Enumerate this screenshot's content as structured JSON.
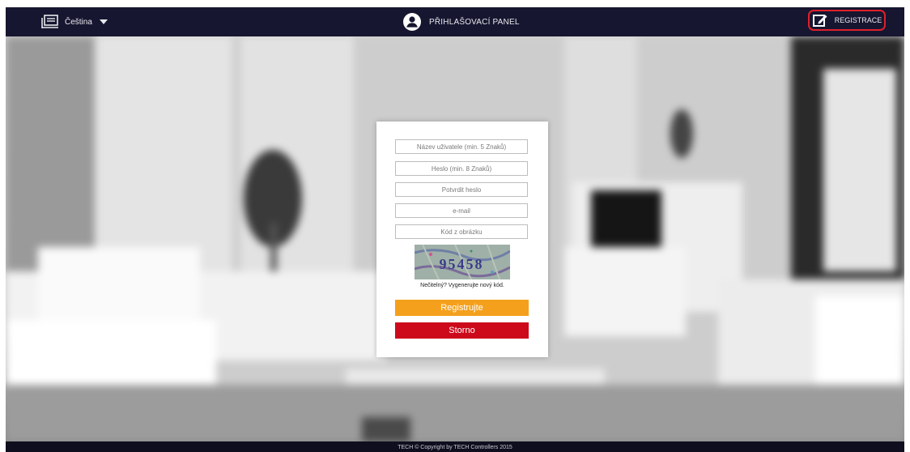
{
  "header": {
    "language": "Čeština",
    "panel_title": "PŘIHLAŠOVACÍ PANEL",
    "register_link": "REGISTRACE"
  },
  "form": {
    "username_placeholder": "Název uživatele (min. 5 Znaků)",
    "password_placeholder": "Heslo (min. 8 Znaků)",
    "confirm_password_placeholder": "Potvrdit heslo",
    "email_placeholder": "e-mail",
    "captcha_code_placeholder": "Kód z obrázku",
    "captcha_text": "95458",
    "refresh_captcha": "Nečitelný? Vygenerujte nový kód.",
    "register_button": "Registrujte",
    "cancel_button": "Storno"
  },
  "footer": {
    "copyright": "TECH © Copyright by TECH Controllers 2015"
  },
  "colors": {
    "topbar": "#161630",
    "register_button": "#f4a01c",
    "cancel_button": "#cc0a1c",
    "highlight": "#e0202b"
  },
  "icons": {
    "language": "panel-icon",
    "panel": "user-circle-icon",
    "register": "edit-icon"
  }
}
